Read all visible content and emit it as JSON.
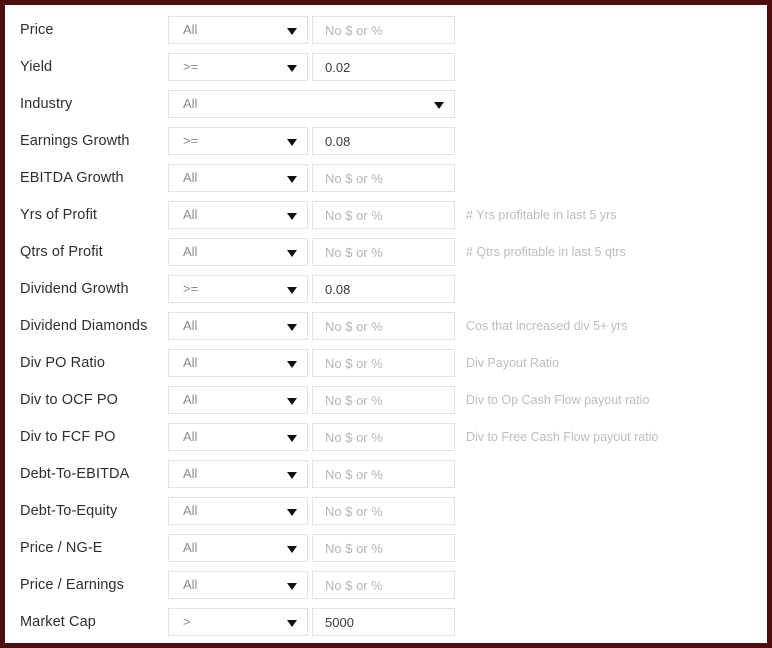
{
  "theme": {
    "border_color": "#4d0f0f",
    "label_color": "#2e2e2e",
    "placeholder_color": "#b5b5b5",
    "hint_color": "#bdbdbd",
    "field_border": "#e2e2e2"
  },
  "icons": {
    "caret": "chevron-down-icon"
  },
  "defaults": {
    "operator_all": "All",
    "placeholder": "No $ or %"
  },
  "filters": [
    {
      "label": "Price",
      "operator": "All",
      "value": "",
      "placeholder": "No $ or %",
      "hint": "",
      "full_width": false
    },
    {
      "label": "Yield",
      "operator": ">=",
      "value": "0.02",
      "placeholder": "No $ or %",
      "hint": "",
      "full_width": false
    },
    {
      "label": "Industry",
      "operator": "All",
      "value": "",
      "placeholder": "",
      "hint": "",
      "full_width": true
    },
    {
      "label": "Earnings Growth",
      "operator": ">=",
      "value": "0.08",
      "placeholder": "No $ or %",
      "hint": "",
      "full_width": false
    },
    {
      "label": "EBITDA Growth",
      "operator": "All",
      "value": "",
      "placeholder": "No $ or %",
      "hint": "",
      "full_width": false
    },
    {
      "label": "Yrs of Profit",
      "operator": "All",
      "value": "",
      "placeholder": "No $ or %",
      "hint": "# Yrs profitable in last 5 yrs",
      "full_width": false
    },
    {
      "label": "Qtrs of Profit",
      "operator": "All",
      "value": "",
      "placeholder": "No $ or %",
      "hint": "# Qtrs profitable in last 5 qtrs",
      "full_width": false
    },
    {
      "label": "Dividend Growth",
      "operator": ">=",
      "value": "0.08",
      "placeholder": "No $ or %",
      "hint": "",
      "full_width": false
    },
    {
      "label": "Dividend Diamonds",
      "operator": "All",
      "value": "",
      "placeholder": "No $ or %",
      "hint": "Cos that increased div 5+ yrs",
      "full_width": false
    },
    {
      "label": "Div PO Ratio",
      "operator": "All",
      "value": "",
      "placeholder": "No $ or %",
      "hint": "Div Payout Ratio",
      "full_width": false
    },
    {
      "label": "Div to OCF PO",
      "operator": "All",
      "value": "",
      "placeholder": "No $ or %",
      "hint": "Div to Op Cash Flow payout ratio",
      "full_width": false
    },
    {
      "label": "Div to FCF PO",
      "operator": "All",
      "value": "",
      "placeholder": "No $ or %",
      "hint": "Div to Free Cash Flow payout ratio",
      "full_width": false
    },
    {
      "label": "Debt-To-EBITDA",
      "operator": "All",
      "value": "",
      "placeholder": "No $ or %",
      "hint": "",
      "full_width": false
    },
    {
      "label": "Debt-To-Equity",
      "operator": "All",
      "value": "",
      "placeholder": "No $ or %",
      "hint": "",
      "full_width": false
    },
    {
      "label": "Price / NG-E",
      "operator": "All",
      "value": "",
      "placeholder": "No $ or %",
      "hint": "",
      "full_width": false
    },
    {
      "label": "Price / Earnings",
      "operator": "All",
      "value": "",
      "placeholder": "No $ or %",
      "hint": "",
      "full_width": false
    },
    {
      "label": "Market Cap",
      "operator": ">",
      "value": "5000",
      "placeholder": "No $ or %",
      "hint": "",
      "full_width": false
    }
  ]
}
